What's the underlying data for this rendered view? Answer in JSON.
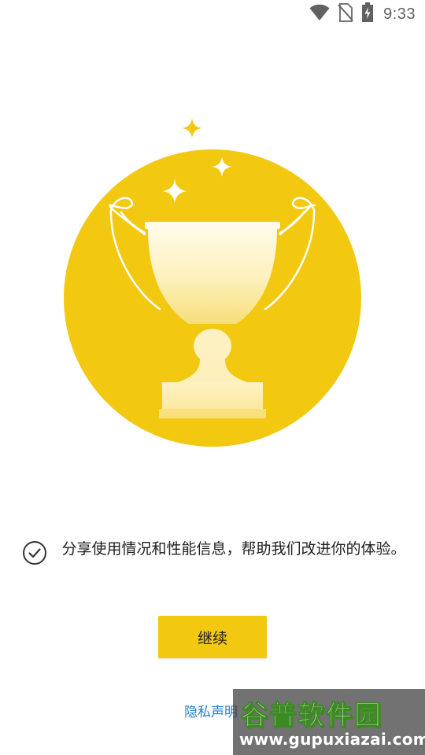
{
  "status_bar": {
    "time": "9:33",
    "icons": [
      "wifi-icon",
      "no-sim-icon",
      "battery-charging-icon"
    ]
  },
  "hero": {
    "icon": "trophy-icon",
    "decorations": [
      "sparkle-icon",
      "sparkle-icon",
      "sparkle-icon"
    ],
    "colors": {
      "circle": "#f2c811",
      "trophy": "#fdf4c8"
    }
  },
  "consent": {
    "checked": true,
    "icon": "check-circle-icon",
    "text": "分享使用情况和性能信息，帮助我们改进你的体验。"
  },
  "continue_button": {
    "label": "继续",
    "color": "#f2c811"
  },
  "privacy": {
    "link_label": "隐私声明"
  },
  "watermark": {
    "title": "谷普软件园",
    "url": "www.gupuxiazai.com"
  }
}
